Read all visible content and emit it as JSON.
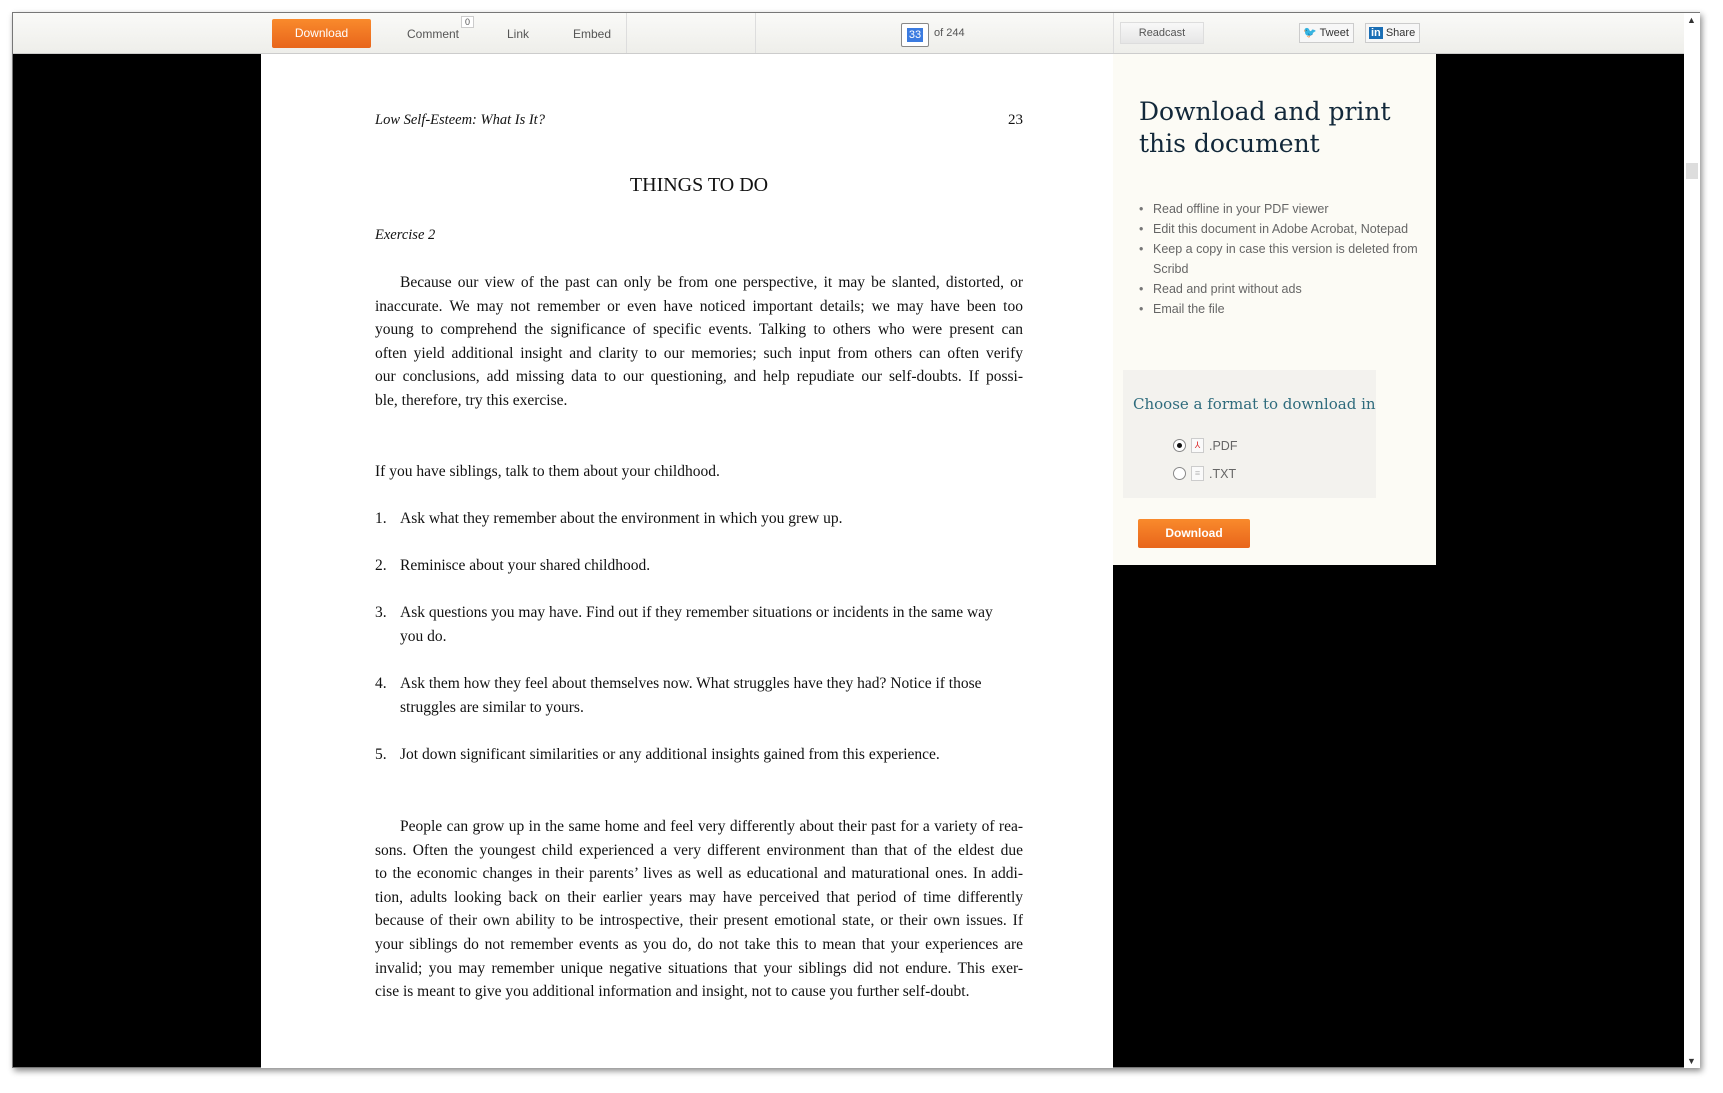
{
  "toolbar": {
    "download": "Download",
    "comment": "Comment",
    "comment_count": "0",
    "link": "Link",
    "embed": "Embed",
    "page_current": "33",
    "page_total": "of 244",
    "readcast": "Readcast",
    "tweet": "Tweet",
    "share": "Share",
    "accent": "#f07a22"
  },
  "document": {
    "running_head": "Low Self-Esteem: What Is It?",
    "page_number": "23",
    "heading": "THINGS TO DO",
    "subheading": "Exercise 2",
    "para1": [
      "Because our view of the past can only be from one perspective, it may be slanted, distorted, or",
      "inaccurate. We may not remember or even have noticed important details; we may have been too",
      "young to comprehend the significance of specific events. Talking to others who were present can",
      "often yield additional insight and clarity to our memories; such input from others can often verify",
      "our conclusions, add missing data to our questioning, and help repudiate our self-doubts. If possi-",
      "ble, therefore, try this exercise."
    ],
    "intro": "If you have siblings, talk to them about your childhood.",
    "items": [
      {
        "n": "1.",
        "lines": [
          "Ask what they remember about the environment in which you grew up."
        ]
      },
      {
        "n": "2.",
        "lines": [
          "Reminisce about your shared childhood."
        ]
      },
      {
        "n": "3.",
        "lines": [
          "Ask questions you may have. Find out if they remember situations or incidents in the same way",
          "you do."
        ]
      },
      {
        "n": "4.",
        "lines": [
          "Ask them how they feel about themselves now. What struggles have they had? Notice if those",
          "struggles are similar to yours."
        ]
      },
      {
        "n": "5.",
        "lines": [
          "Jot down significant similarities or any additional insights gained from this experience."
        ]
      }
    ],
    "para2": [
      "People can grow up in the same home and feel very differently about their past for a variety of rea-",
      "sons. Often the youngest child experienced a very different environment than that of the eldest due",
      "to the economic changes in their parents’ lives as well as educational and maturational ones. In addi-",
      "tion, adults looking back on their earlier years may have perceived that period of time differently",
      "because of their own ability to be introspective, their present emotional state, or their own issues. If",
      "your siblings do not remember events as you do, do not take this to mean that your experiences are",
      "invalid; you may remember unique negative situations that your siblings did not endure. This exer-",
      "cise is meant to give you additional information and insight, not to cause you further self-doubt."
    ]
  },
  "sidebar": {
    "title": "Download and print this document",
    "benefits": [
      "Read offline in your PDF viewer",
      "Edit this document in Adobe Acrobat, Notepad",
      "Keep a copy in case this version is deleted from Scribd",
      "Read and print without ads",
      "Email the file"
    ],
    "format_heading": "Choose a format to download in",
    "formats": [
      {
        "label": ".PDF",
        "selected": true,
        "icon": "pdf-file-icon"
      },
      {
        "label": ".TXT",
        "selected": false,
        "icon": "text-file-icon"
      }
    ],
    "download": "Download"
  }
}
